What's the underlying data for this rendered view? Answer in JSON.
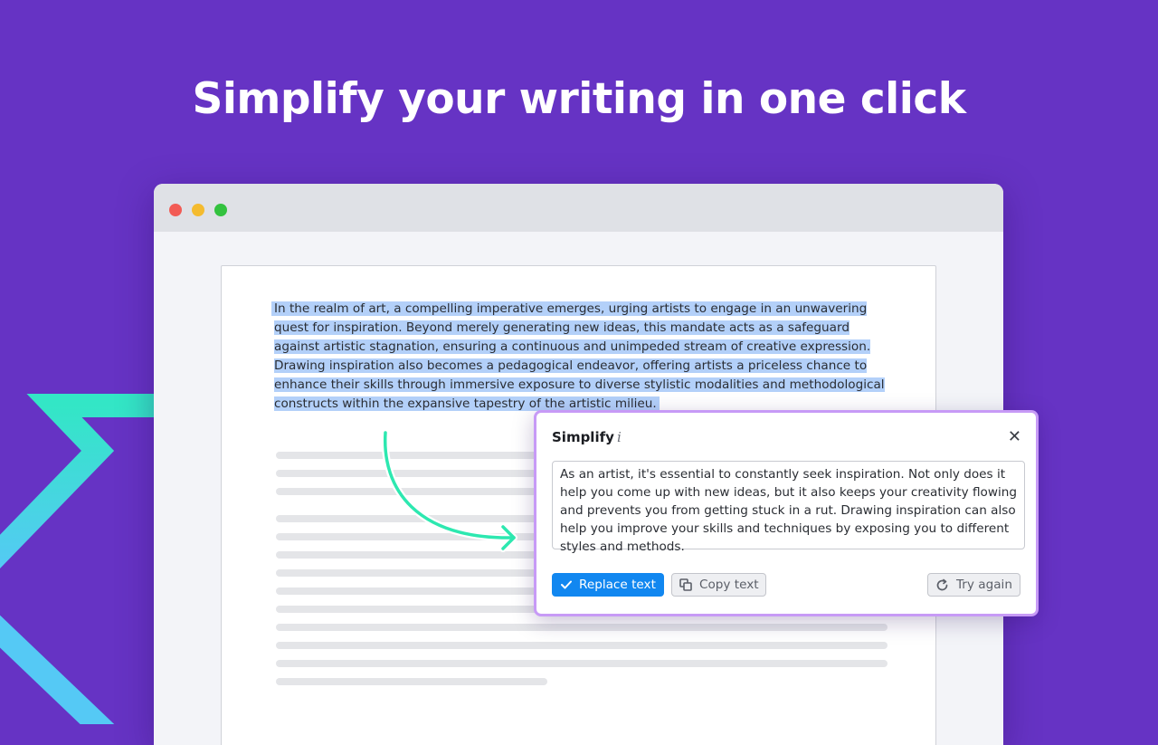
{
  "headline": "Simplify your writing in one click",
  "document": {
    "selected_text": "In the realm of art, a compelling imperative emerges, urging artists to engage in an unwavering quest for inspiration. Beyond merely generating new ideas, this mandate acts as a safeguard against artistic stagnation, ensuring a continuous and unimpeded stream of creative expression. Drawing inspiration also becomes a pedagogical endeavor, offering artists a priceless chance to enhance their skills through immersive exposure to diverse stylistic modalities and methodological constructs within the expansive tapestry of the artistic milieu."
  },
  "popup": {
    "title": "Simplify",
    "info_icon": "i",
    "close_icon": "✕",
    "result_text": "As an artist, it's essential to constantly seek inspiration. Not only does it help you come up with new ideas, but it also keeps your creativity flowing and prevents you from getting stuck in a rut. Drawing inspiration can also help you improve your skills and techniques by exposing you to different styles and methods.",
    "replace_label": "Replace text",
    "copy_label": "Copy text",
    "try_again_label": "Try again"
  },
  "colors": {
    "background": "#6633c4",
    "accent": "#1187f0",
    "selection": "#b3d0f9",
    "popup_border": "#c79af6",
    "arrow": "#2de8b0"
  },
  "icons": {
    "check": "check-icon",
    "copy": "copy-icon",
    "retry": "refresh-icon",
    "info": "info-icon",
    "close": "close-icon"
  }
}
